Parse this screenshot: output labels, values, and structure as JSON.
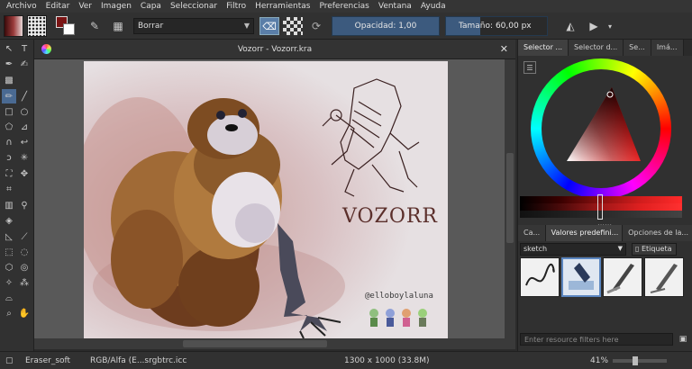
{
  "menu": [
    "Archivo",
    "Editar",
    "Ver",
    "Imagen",
    "Capa",
    "Seleccionar",
    "Filtro",
    "Herramientas",
    "Preferencias",
    "Ventana",
    "Ayuda"
  ],
  "toolbar": {
    "preset_name": "Borrar",
    "opacity_label": "Opacidad:",
    "opacity_value": "1,00",
    "size_label": "Tamaño:",
    "size_value": "60,00 px",
    "fg_color": "#7a1414",
    "bg_color": "#ffffff"
  },
  "document": {
    "tab_title": "Vozorr - Vozorr.kra",
    "art_title": "VOZORR",
    "art_handle": "@elloboylaluna"
  },
  "dock": {
    "top_tabs": [
      "Selector ...",
      "Selector d...",
      "Se...",
      "Imá..."
    ],
    "bottom_tabs": [
      "Ca...",
      "Valores predefini...",
      "Opciones de la..."
    ],
    "tag_value": "sketch",
    "tag_button": "Etiqueta",
    "filter_placeholder": "Enter resource filters here"
  },
  "status": {
    "preset": "Eraser_soft",
    "colorspace": "RGB/Alfa (E...srgbtrc.icc",
    "dimensions": "1300 x 1000 (33.8M)",
    "zoom": "41%"
  }
}
